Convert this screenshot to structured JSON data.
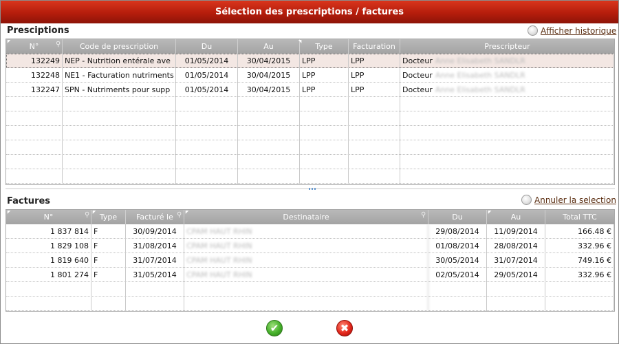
{
  "window": {
    "title": "Sélection des prescriptions / factures"
  },
  "colors": {
    "titlebar": "#c0260f",
    "header": "#aeaeae",
    "selected_row": "#f3e7e3",
    "link": "#5a2d10"
  },
  "prescriptions": {
    "title": "Presciptions",
    "history_link": "Afficher historique",
    "columns": [
      "N°",
      "Code de prescription",
      "Du",
      "Au",
      "Type",
      "Facturation",
      "Prescripteur"
    ],
    "rows": [
      {
        "no": "132249",
        "code": "NEP - Nutrition entérale ave",
        "du": "01/05/2014",
        "au": "30/04/2015",
        "type": "LPP",
        "facturation": "LPP",
        "prescripteur": "Docteur",
        "prescripteur_name": "Anne Elisabeth SANDLR"
      },
      {
        "no": "132248",
        "code": "NE1 - Facturation nutriments",
        "du": "01/05/2014",
        "au": "30/04/2015",
        "type": "LPP",
        "facturation": "LPP",
        "prescripteur": "Docteur",
        "prescripteur_name": "Anne Elisabeth SANDLR"
      },
      {
        "no": "132247",
        "code": "SPN - Nutriments pour supp",
        "du": "01/05/2014",
        "au": "30/04/2015",
        "type": "LPP",
        "facturation": "LPP",
        "prescripteur": "Docteur",
        "prescripteur_name": "Anne Elisabeth SANDLR"
      }
    ]
  },
  "factures": {
    "title": "Factures",
    "cancel_link": "Annuler la selection",
    "columns": [
      "N°",
      "Type",
      "Facturé le",
      "Destinataire",
      "Du",
      "Au",
      "Total TTC"
    ],
    "rows": [
      {
        "no": "1 837 814",
        "type": "F",
        "facture_le": "30/09/2014",
        "destinataire": "CPAM HAUT RHIN",
        "du": "29/08/2014",
        "au": "11/09/2014",
        "total": "166.48 €"
      },
      {
        "no": "1 829 108",
        "type": "F",
        "facture_le": "31/08/2014",
        "destinataire": "CPAM HAUT RHIN",
        "du": "01/08/2014",
        "au": "28/08/2014",
        "total": "332.96 €"
      },
      {
        "no": "1 819 640",
        "type": "F",
        "facture_le": "31/07/2014",
        "destinataire": "CPAM HAUT RHIN",
        "du": "30/05/2014",
        "au": "31/07/2014",
        "total": "749.16 €"
      },
      {
        "no": "1 801 274",
        "type": "F",
        "facture_le": "31/05/2014",
        "destinataire": "CPAM HAUT RHIN",
        "du": "02/05/2014",
        "au": "29/05/2014",
        "total": "332.96 €"
      }
    ]
  },
  "actions": {
    "ok_icon": "check-icon",
    "cancel_icon": "close-icon"
  }
}
